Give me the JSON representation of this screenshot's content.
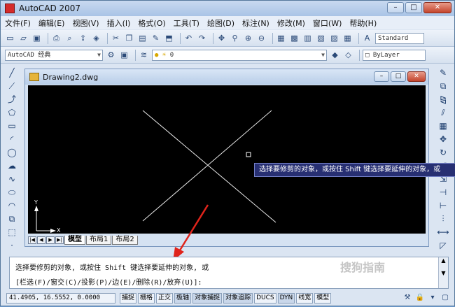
{
  "app": {
    "title": "AutoCAD 2007"
  },
  "window_buttons": {
    "minimize": "–",
    "maximize": "□",
    "close": "✕"
  },
  "menu": [
    "文件(F)",
    "编辑(E)",
    "视图(V)",
    "插入(I)",
    "格式(O)",
    "工具(T)",
    "绘图(D)",
    "标注(N)",
    "修改(M)",
    "窗口(W)",
    "帮助(H)"
  ],
  "toolbar1": {
    "icons": [
      "new-file-icon",
      "open-icon",
      "save-icon",
      "plot-icon",
      "plot-preview-icon",
      "publish-icon",
      "3d-icon",
      "cut-icon",
      "copy-icon",
      "paste-icon",
      "match-properties-icon",
      "block-editor-icon",
      "undo-icon",
      "redo-icon",
      "pan-icon",
      "zoom-realtime-icon",
      "zoom-window-icon",
      "zoom-previous-icon",
      "properties-icon",
      "design-center-icon",
      "tool-palettes-icon",
      "sheet-set-icon",
      "markup-icon",
      "calculator-icon",
      "text-style-icon"
    ],
    "text_style": "Standard"
  },
  "toolbar2": {
    "workspace": "AutoCAD 经典",
    "layer_value": "0",
    "color_value": "ByLayer"
  },
  "document": {
    "title": "Drawing2.dwg",
    "ucs_y_label": "Y",
    "ucs_x_label": "X"
  },
  "layout_tabs": [
    "模型",
    "布局1",
    "布局2"
  ],
  "tooltip": "选择要修剪的对象，或按住 Shift 键选择要延伸的对象，或",
  "command": {
    "line1": "选择要修剪的对象, 或按住 Shift 键选择要延伸的对象, 或",
    "line2": "[栏选(F)/窗交(C)/投影(P)/边(E)/删除(R)/放弃(U)]:"
  },
  "status": {
    "coordinates": "41.4905, 16.5552, 0.0000",
    "buttons": [
      "捕捉",
      "栅格",
      "正交",
      "极轴",
      "对象捕捉",
      "对象追踪",
      "DUCS",
      "DYN",
      "线宽",
      "模型"
    ]
  },
  "left_tools": [
    "line-icon",
    "construction-line-icon",
    "polyline-icon",
    "polygon-icon",
    "rectangle-icon",
    "arc-icon",
    "circle-icon",
    "revision-cloud-icon",
    "spline-icon",
    "ellipse-icon",
    "ellipse-arc-icon",
    "insert-block-icon",
    "make-block-icon",
    "point-icon"
  ],
  "right_tools": [
    "erase-icon",
    "copy-object-icon",
    "mirror-icon",
    "offset-icon",
    "array-icon",
    "move-icon",
    "rotate-icon",
    "scale-icon",
    "stretch-icon",
    "trim-icon",
    "extend-icon",
    "break-icon",
    "join-icon",
    "chamfer-icon",
    "fillet-icon",
    "explode-icon"
  ],
  "colors": {
    "canvas": "#000000",
    "tooltip": "#272f72",
    "annotation_arrow": "#e0241b"
  },
  "watermark": "搜狗指南"
}
